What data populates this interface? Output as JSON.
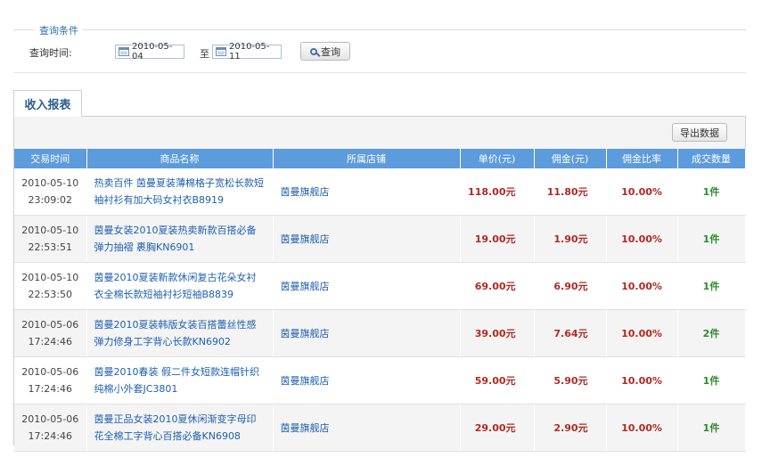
{
  "query": {
    "legend": "查询条件",
    "time_label": "查询时间:",
    "start_date": "2010-05-04",
    "to_label": "至",
    "end_date": "2010-05-11",
    "search_label": "查询"
  },
  "tab": {
    "label": "收入报表"
  },
  "toolbar": {
    "export_label": "导出数据"
  },
  "table": {
    "headers": [
      "交易时间",
      "商品名称",
      "所属店铺",
      "单价(元)",
      "佣金(元)",
      "佣金比率",
      "成交数量"
    ],
    "rows": [
      {
        "date": "2010-05-10",
        "time": "23:09:02",
        "name": "热卖百件 茵曼夏装薄棉格子宽松长款短袖衬衫有加大码女衬衣B8919",
        "shop": "茵曼旗舰店",
        "price": "118.00元",
        "commission": "11.80元",
        "rate": "10.00%",
        "qty": "1件"
      },
      {
        "date": "2010-05-10",
        "time": "22:53:51",
        "name": "茵曼女装2010夏装热卖新款百搭必备弹力抽褶 裹胸KN6901",
        "shop": "茵曼旗舰店",
        "price": "19.00元",
        "commission": "1.90元",
        "rate": "10.00%",
        "qty": "1件"
      },
      {
        "date": "2010-05-10",
        "time": "22:53:50",
        "name": "茵曼2010夏装新款休闲复古花朵女衬衣全棉长款短袖衬衫短袖B8839",
        "shop": "茵曼旗舰店",
        "price": "69.00元",
        "commission": "6.90元",
        "rate": "10.00%",
        "qty": "1件"
      },
      {
        "date": "2010-05-06",
        "time": "17:24:46",
        "name": "茵曼2010夏装韩版女装百搭蕾丝性感弹力修身工字背心长款KN6902",
        "shop": "茵曼旗舰店",
        "price": "39.00元",
        "commission": "7.64元",
        "rate": "10.00%",
        "qty": "2件"
      },
      {
        "date": "2010-05-06",
        "time": "17:24:46",
        "name": "茵曼2010春装 假二件女短款连帽针织纯棉小外套JC3801",
        "shop": "茵曼旗舰店",
        "price": "59.00元",
        "commission": "5.90元",
        "rate": "10.00%",
        "qty": "1件"
      },
      {
        "date": "2010-05-06",
        "time": "17:24:46",
        "name": "茵曼正品女装2010夏休闲渐变字母印花全棉工字背心百搭必备KN6908",
        "shop": "茵曼旗舰店",
        "price": "29.00元",
        "commission": "2.90元",
        "rate": "10.00%",
        "qty": "1件"
      }
    ]
  },
  "colors": {
    "header_bg": "#5c9bdc",
    "price": "#b02a20",
    "qty": "#2e8a2e",
    "link": "#1f5fae"
  }
}
